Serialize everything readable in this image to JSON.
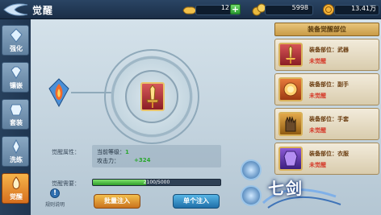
{
  "header": {
    "title": "觉醒",
    "currency_1": "12",
    "currency_2": "5998",
    "currency_3": "13.41万"
  },
  "tabs": [
    {
      "label": "强化"
    },
    {
      "label": "镶嵌"
    },
    {
      "label": "套装"
    },
    {
      "label": "洗练"
    },
    {
      "label": "觉醒"
    }
  ],
  "main": {
    "attr_label": "觉醒属性：",
    "level_label": "当前等级：",
    "level_value": "1",
    "atk_label": "攻击力：",
    "atk_value": "+324",
    "need_label": "觉醒需要：",
    "progress_text": "2100/5000",
    "progress_fraction": 0.42,
    "batch_button": "批量注入",
    "single_button": "单个注入",
    "help_label": "规则说明"
  },
  "slots": {
    "header": "装备觉醒部位",
    "items": [
      {
        "name": "装备部位：武器",
        "state": "未觉醒"
      },
      {
        "name": "装备部位：副手",
        "state": "未觉醒"
      },
      {
        "name": "装备部位：手套",
        "state": "未觉醒"
      },
      {
        "name": "装备部位：衣服",
        "state": "未觉醒"
      }
    ]
  },
  "logo": "七剑",
  "colors": {
    "accent_orange": "#f3a33c",
    "status_red": "#d53a2a",
    "value_green": "#2aa72e"
  }
}
